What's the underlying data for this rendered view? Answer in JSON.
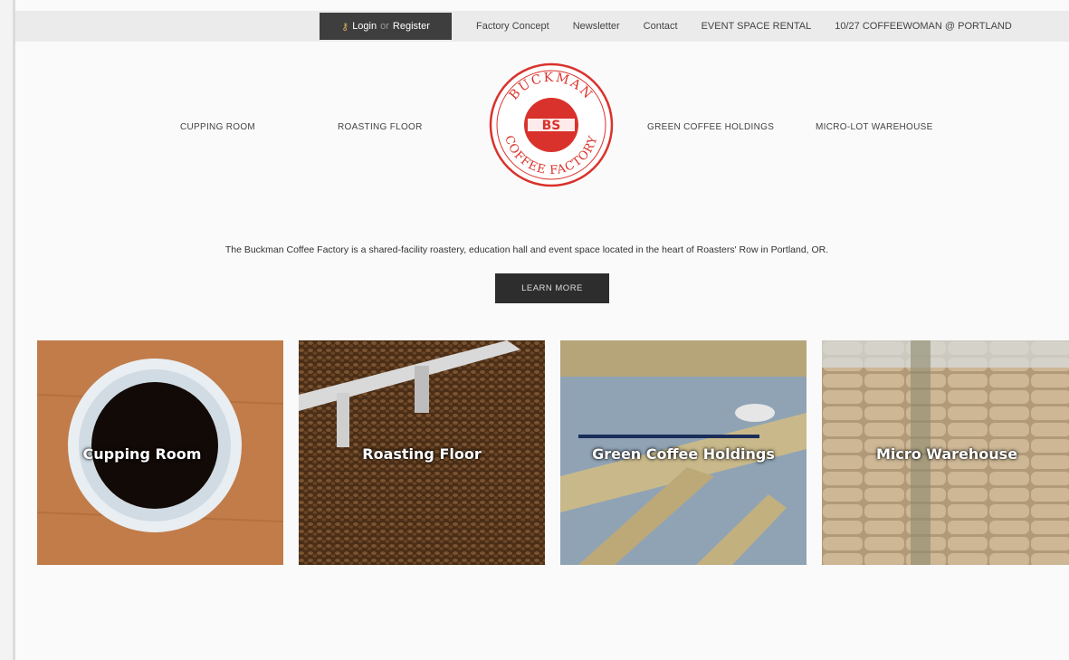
{
  "topbar": {
    "login_label": "Login",
    "or_label": "or",
    "register_label": "Register",
    "links": [
      "Factory Concept",
      "Newsletter",
      "Contact",
      "EVENT SPACE RENTAL",
      "10/27 COFFEEWOMAN @ PORTLAND"
    ]
  },
  "nav": {
    "cupping_room": "CUPPING ROOM",
    "roasting_floor": "ROASTING FLOOR",
    "green_coffee": "GREEN COFFEE HOLDINGS",
    "micro_lot": "MICRO-LOT WAREHOUSE"
  },
  "logo": {
    "top_text": "BUCKMAN",
    "bottom_text": "COFFEE FACTORY",
    "monogram": "BS"
  },
  "hero": {
    "tagline": "The Buckman Coffee Factory is a shared-facility roastery, education hall and event space located in the heart of Roasters' Row in Portland, OR.",
    "button_label": "LEARN MORE"
  },
  "tiles": [
    {
      "label": "Cupping Room"
    },
    {
      "label": "Roasting Floor"
    },
    {
      "label": "Green Coffee Holdings"
    },
    {
      "label": "Micro Warehouse"
    }
  ],
  "colors": {
    "brand_red": "#d9322c",
    "dark_button": "#2d2d2d",
    "login_bg": "#3e3e3e"
  }
}
